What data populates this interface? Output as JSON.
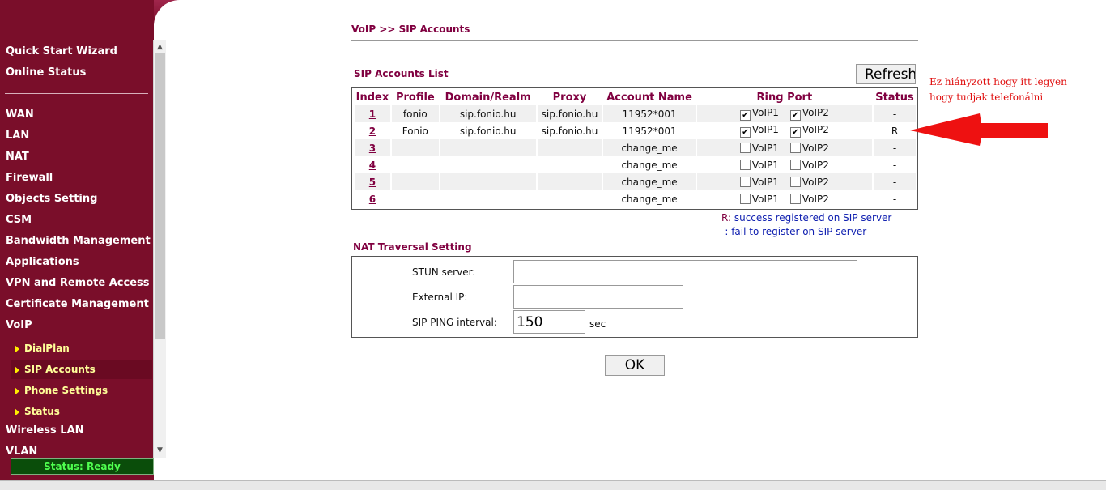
{
  "sidebar": {
    "top_items": [
      "Quick Start Wizard",
      "Online Status"
    ],
    "items": [
      "WAN",
      "LAN",
      "NAT",
      "Firewall",
      "Objects Setting",
      "CSM",
      "Bandwidth Management",
      "Applications",
      "VPN and Remote Access",
      "Certificate Management",
      "VoIP"
    ],
    "voip_subitems": [
      "DialPlan",
      "SIP Accounts",
      "Phone Settings",
      "Status"
    ],
    "bottom_items": [
      "Wireless LAN",
      "VLAN"
    ],
    "status": "Status: Ready"
  },
  "breadcrumb": "VoIP >> SIP Accounts",
  "sip_list": {
    "title": "SIP Accounts List",
    "refresh_label": "Refresh",
    "columns": [
      "Index",
      "Profile",
      "Domain/Realm",
      "Proxy",
      "Account Name",
      "Ring Port",
      "Status"
    ],
    "voip1_label": "VoIP1",
    "voip2_label": "VoIP2",
    "rows": [
      {
        "index": "1",
        "profile": "fonio",
        "domain": "sip.fonio.hu",
        "proxy": "sip.fonio.hu",
        "account": "11952*001",
        "voip1": true,
        "voip2": true,
        "status": "-"
      },
      {
        "index": "2",
        "profile": "Fonio",
        "domain": "sip.fonio.hu",
        "proxy": "sip.fonio.hu",
        "account": "11952*001",
        "voip1": true,
        "voip2": true,
        "status": "R"
      },
      {
        "index": "3",
        "profile": "",
        "domain": "",
        "proxy": "",
        "account": "change_me",
        "voip1": false,
        "voip2": false,
        "status": "-"
      },
      {
        "index": "4",
        "profile": "",
        "domain": "",
        "proxy": "",
        "account": "change_me",
        "voip1": false,
        "voip2": false,
        "status": "-"
      },
      {
        "index": "5",
        "profile": "",
        "domain": "",
        "proxy": "",
        "account": "change_me",
        "voip1": false,
        "voip2": false,
        "status": "-"
      },
      {
        "index": "6",
        "profile": "",
        "domain": "",
        "proxy": "",
        "account": "change_me",
        "voip1": false,
        "voip2": false,
        "status": "-"
      }
    ]
  },
  "legend": {
    "r_key": "R:",
    "r_text": " success registered on SIP server",
    "dash_key": "-:",
    "dash_text": " fail to register on SIP server"
  },
  "annotation": {
    "line1": "Ez hiányzott hogy itt legyen",
    "line2": "hogy tudjak telefonálni",
    "color": "#e01010"
  },
  "nat": {
    "title": "NAT Traversal Setting",
    "stun_label": "STUN server:",
    "stun_value": "",
    "external_ip_label": "External IP:",
    "external_ip_value": "",
    "ping_label": "SIP PING interval:",
    "ping_value": "150",
    "ping_unit": "sec"
  },
  "ok_label": "OK",
  "colors": {
    "sidebar_bg": "#7a0e2a",
    "heading": "#800040",
    "legend_text": "#1020b0",
    "status_text": "#4fff4f"
  }
}
